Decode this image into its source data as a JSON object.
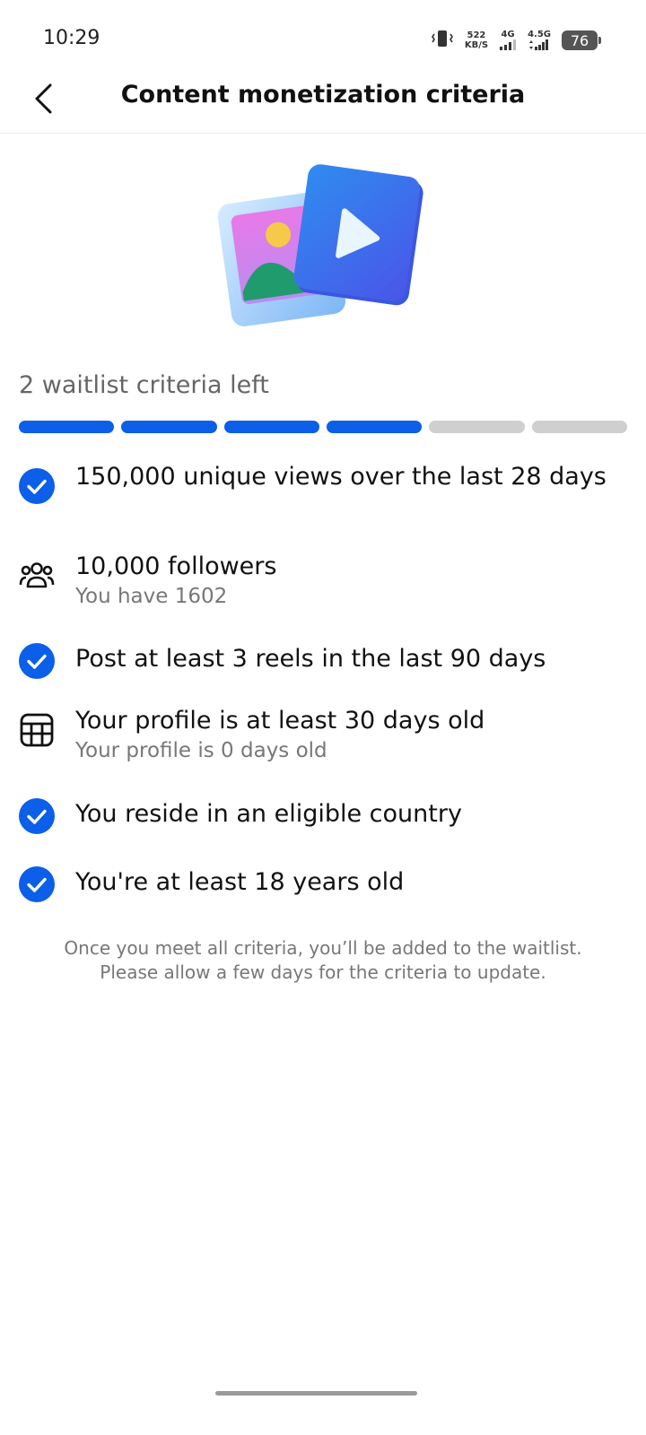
{
  "status_bar": {
    "time": "10:29",
    "net_speed_value": "522",
    "net_speed_unit": "KB/S",
    "signal_1": "4G",
    "signal_2": "4.5G",
    "battery": "76"
  },
  "header": {
    "title": "Content monetization criteria"
  },
  "progress": {
    "label": "2 waitlist criteria left",
    "total_segments": 6,
    "completed_segments": 4
  },
  "criteria": [
    {
      "title": "150,000 unique views over the last 28 days",
      "subtitle": "",
      "status": "met",
      "icon": "check-circle-icon"
    },
    {
      "title": "10,000 followers",
      "subtitle": "You have 1602",
      "status": "unmet",
      "icon": "people-icon"
    },
    {
      "title": "Post at least 3 reels in the last 90 days",
      "subtitle": "",
      "status": "met",
      "icon": "check-circle-icon"
    },
    {
      "title": "Your profile is at least 30 days old",
      "subtitle": "Your profile is 0 days old",
      "status": "unmet",
      "icon": "calendar-icon"
    },
    {
      "title": "You reside in an eligible country",
      "subtitle": "",
      "status": "met",
      "icon": "check-circle-icon"
    },
    {
      "title": "You're at least 18 years old",
      "subtitle": "",
      "status": "met",
      "icon": "check-circle-icon"
    }
  ],
  "footnote": {
    "line1": "Once you meet all criteria, you’ll be added to the waitlist.",
    "line2": "Please allow a few days for the criteria to update."
  },
  "colors": {
    "accent": "#0b5fe8",
    "progress_empty": "#cfcfcf",
    "muted_text": "#777777"
  }
}
